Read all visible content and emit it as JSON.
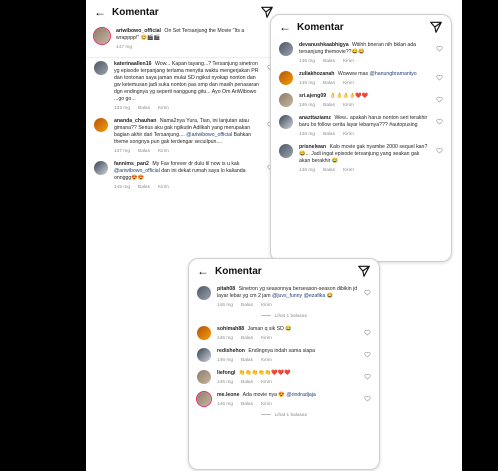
{
  "panels": [
    {
      "title": "Komentar",
      "caption": {
        "user": "ariwibowo_official",
        "text": "On Set Tersanjung the Movie \"Its a wrapppp!\" 😊🎬🎬",
        "time": "147 mg"
      },
      "comments": [
        {
          "user": "katerinaallen16",
          "text": "Wow... Kapan tayang...? Tersanjung sinetron yg episode terpanjang terlama menyita waktu mengerjakan PR dan tontonan saya jaman mulai SD ngikut nyokap nonton dan gw ketemusan jadi suka nonton pas smp dan masih penasaran dgn endingnya yg seperti nanggung gitu... Ayo Om AriWibowo ...go go...",
          "time": "133 mg",
          "reply": "Balas",
          "send": "Kirim"
        },
        {
          "user": "ananda_chauhan",
          "text": "Nama2nya Yura, Tian, ini lanjutan atau gimana?? Serius aku gak ngikutin Adilkah yang merupakan bagian akhir dari Tersanjung....",
          "mention": "@ariwibowo_official",
          "text2": "Bahkan theme songnya pun gak terdengar secuilpun....",
          "time": "137 mg",
          "reply": "Balas",
          "send": "Kirim"
        },
        {
          "user": "fannims_pan2",
          "text": "My Fav forever dr dulu til now is u kak",
          "mention": "@ariwibowo_official",
          "text2": "dan ini dekat rumah saya lo kalianda onnggg😍😍",
          "time": "145 mg",
          "reply": "Balas",
          "send": "Kirim"
        }
      ]
    },
    {
      "title": "Komentar",
      "comments": [
        {
          "user": "devanushkaabhigya",
          "text": "Wiiihh bneran nih bklan ada tersanjung themovie??😂😂",
          "time": "146 mg",
          "reply": "Balas",
          "send": "Kirim"
        },
        {
          "user": "zuliakhozanah",
          "text": "Wowww mas",
          "mention": "@hanungbramantyo",
          "text2": "",
          "time": "146 mg",
          "reply": "Balas",
          "send": "Kirim"
        },
        {
          "user": "sri.ajeng09",
          "text": "👌👌👌👌❤️❤️",
          "time": "146 mg",
          "reply": "Balas",
          "send": "Kirim"
        },
        {
          "user": "anazttaziamz",
          "text": "Wew.. apakah harus nonton seri terakhir baru bs follow cerita layar lebarnya??? #autopusing",
          "time": "146 mg",
          "reply": "Balas",
          "send": "Kirim"
        },
        {
          "user": "prisnelwan",
          "text": "Kalo movie gak nyambe 2000 sequel kan? 😂... Jadi ingat episode tersanjung yang seakan gak akan berakhir 😂",
          "time": "146 mg",
          "reply": "Balas",
          "send": "Kirim"
        }
      ]
    },
    {
      "title": "Komentar",
      "view_more": "Lihat 1 balasan",
      "view_more_bottom": "Lihat 1 balasan",
      "comments": [
        {
          "user": "pitah08",
          "text": "Sinetron yg seasonnya berseason-season dibikin jd layar lebar yg cm 2 jam",
          "mention": "@juvs_funny @ezafika",
          "text2": "😂",
          "time": "146 mg",
          "reply": "Balas",
          "send": "Kirim"
        },
        {
          "user": "sohimah88",
          "text": "Jaman q sik SD 😂",
          "time": "146 mg",
          "reply": "Balas",
          "send": "Kirim"
        },
        {
          "user": "redishehon",
          "text": "Endingnya indah sama siapa",
          "time": "146 mg",
          "reply": "Balas",
          "send": "Kirim"
        },
        {
          "user": "liefongl",
          "text": "👏👏👏👏👏❤️❤️❤️",
          "time": "146 mg",
          "reply": "Balas",
          "send": "Kirim"
        },
        {
          "user": "me.leone",
          "text": "Ada movie nya 😍",
          "mention": "@rindradjaja",
          "text2": "",
          "time": "146 mg",
          "reply": "Balas",
          "send": "Kirim"
        }
      ]
    }
  ]
}
